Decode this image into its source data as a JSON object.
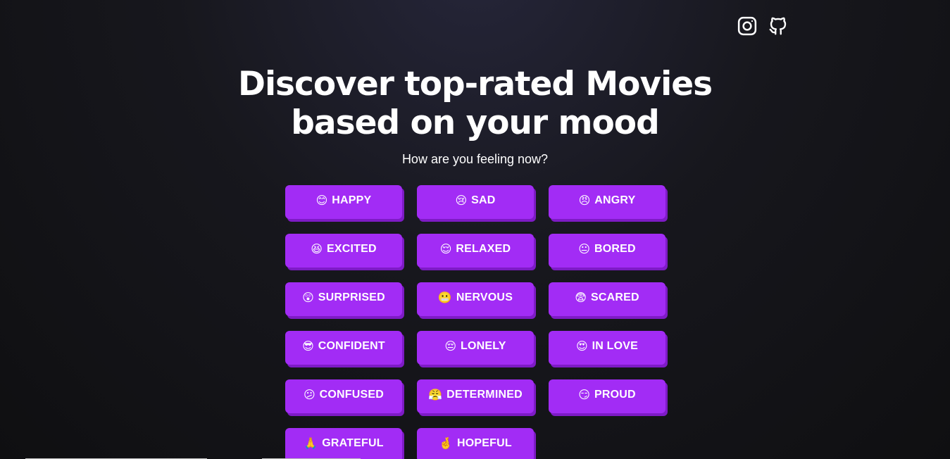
{
  "social": {
    "instagram_icon": "instagram-icon",
    "github_icon": "github-icon"
  },
  "hero": {
    "title_line1": "Discover top-rated Movies",
    "title_line2": "based on your mood",
    "subtitle": "How are you feeling now?"
  },
  "colors": {
    "button_bg": "#a22cf5",
    "button_shadow": "#7e1bc6",
    "page_bg": "#131316",
    "text": "#ffffff"
  },
  "moods": [
    {
      "emoji": "😊",
      "label": "HAPPY"
    },
    {
      "emoji": "😢",
      "label": "SAD"
    },
    {
      "emoji": "😠",
      "label": "ANGRY"
    },
    {
      "emoji": "😆",
      "label": "EXCITED"
    },
    {
      "emoji": "😌",
      "label": "RELAXED"
    },
    {
      "emoji": "😐",
      "label": "BORED"
    },
    {
      "emoji": "😲",
      "label": "SURPRISED"
    },
    {
      "emoji": "😬",
      "label": "NERVOUS"
    },
    {
      "emoji": "😨",
      "label": "SCARED"
    },
    {
      "emoji": "😎",
      "label": "CONFIDENT"
    },
    {
      "emoji": "😔",
      "label": "LONELY"
    },
    {
      "emoji": "😍",
      "label": "IN LOVE"
    },
    {
      "emoji": "😕",
      "label": "CONFUSED"
    },
    {
      "emoji": "😤",
      "label": "DETERMINED"
    },
    {
      "emoji": "😏",
      "label": "PROUD"
    },
    {
      "emoji": "🙏",
      "label": "GRATEFUL"
    },
    {
      "emoji": "🤞",
      "label": "HOPEFUL"
    }
  ]
}
